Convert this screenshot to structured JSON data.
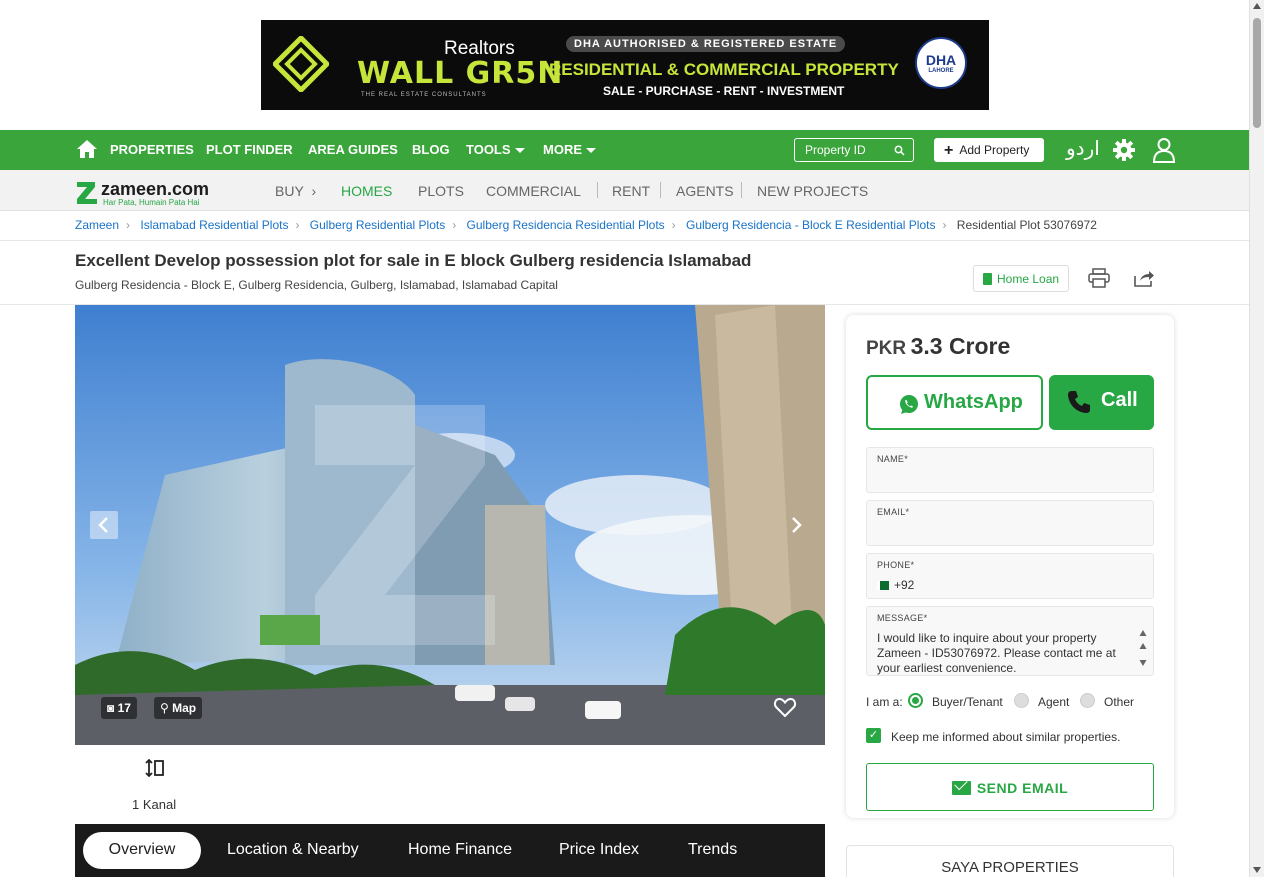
{
  "banner": {
    "realtors": "Realtors",
    "brand": "WALL GR5N",
    "consultants": "THE REAL ESTATE CONSULTANTS",
    "dha_badge": "DHA AUTHORISED & REGISTERED ESTATE",
    "headline": "RESIDENTIAL & COMMERCIAL PROPERTY",
    "services": "SALE - PURCHASE - RENT - INVESTMENT",
    "seal_logo": "DHA",
    "seal_city": "LAHORE"
  },
  "main_nav": {
    "items": [
      "PROPERTIES",
      "PLOT FINDER",
      "AREA GUIDES",
      "BLOG",
      "TOOLS",
      "MORE"
    ],
    "property_id_placeholder": "Property ID",
    "add_property": "Add Property",
    "urdu": "اردو"
  },
  "sub_nav": {
    "logo_name": "zameen.com",
    "logo_tagline": "Har Pata, Humain Pata Hai",
    "items": [
      "BUY",
      "HOMES",
      "PLOTS",
      "COMMERCIAL",
      "RENT",
      "AGENTS",
      "NEW PROJECTS"
    ],
    "active": "HOMES"
  },
  "breadcrumb": {
    "links": [
      "Zameen",
      "Islamabad Residential Plots",
      "Gulberg Residential Plots",
      "Gulberg Residencia Residential Plots",
      "Gulberg Residencia - Block E Residential Plots"
    ],
    "current": "Residential Plot 53076972"
  },
  "listing": {
    "title": "Excellent Develop possession plot for sale in E block Gulberg residencia Islamabad",
    "address": "Gulberg Residencia - Block E, Gulberg Residencia, Gulberg, Islamabad, Islamabad Capital",
    "home_loan": "Home Loan",
    "photo_count": "17",
    "map_label": "Map",
    "area": "1 Kanal"
  },
  "tabs": [
    "Overview",
    "Location & Nearby",
    "Home Finance",
    "Price Index",
    "Trends"
  ],
  "contact": {
    "currency": "PKR",
    "price": "3.3 Crore",
    "whatsapp": "WhatsApp",
    "call": "Call",
    "name_label": "NAME*",
    "email_label": "EMAIL*",
    "phone_label": "PHONE*",
    "phone_value": "+92",
    "message_label": "MESSAGE*",
    "message_value": "I would like to inquire about your property Zameen - ID53076972. Please contact me at your earliest convenience.",
    "iam_label": "I am a:",
    "roles": [
      "Buyer/Tenant",
      "Agent",
      "Other"
    ],
    "selected_role": "Buyer/Tenant",
    "keep_informed": "Keep me informed about similar properties.",
    "send_email": "SEND EMAIL"
  },
  "agency": {
    "name": "SAYA PROPERTIES"
  },
  "colors": {
    "brand_green": "#28a745",
    "nav_green": "#3aa53a",
    "tab_bar": "#1a1a1a",
    "link_blue": "#1a73c8"
  }
}
